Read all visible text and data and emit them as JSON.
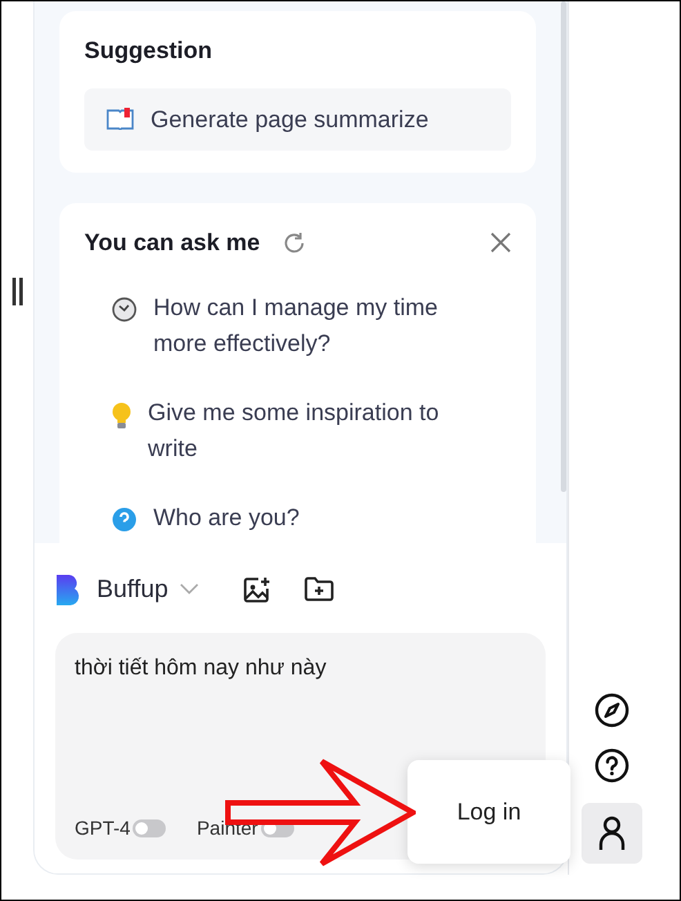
{
  "suggestion": {
    "title": "Suggestion",
    "items": [
      {
        "label": "Generate page summarize"
      }
    ]
  },
  "ask": {
    "title": "You can ask me",
    "items": [
      {
        "kind": "clock",
        "text": "How can I manage my time more effectively?"
      },
      {
        "kind": "bulb",
        "text": "Give me some inspiration to write"
      },
      {
        "kind": "question",
        "text": "Who are you?"
      }
    ]
  },
  "composer": {
    "model": "Buffup",
    "input": {
      "value": "thời tiết hôm nay như này"
    },
    "toggles": [
      {
        "label": "GPT-4",
        "on": false
      },
      {
        "label": "Painter",
        "on": false
      }
    ]
  },
  "popup": {
    "label": "Log in"
  }
}
